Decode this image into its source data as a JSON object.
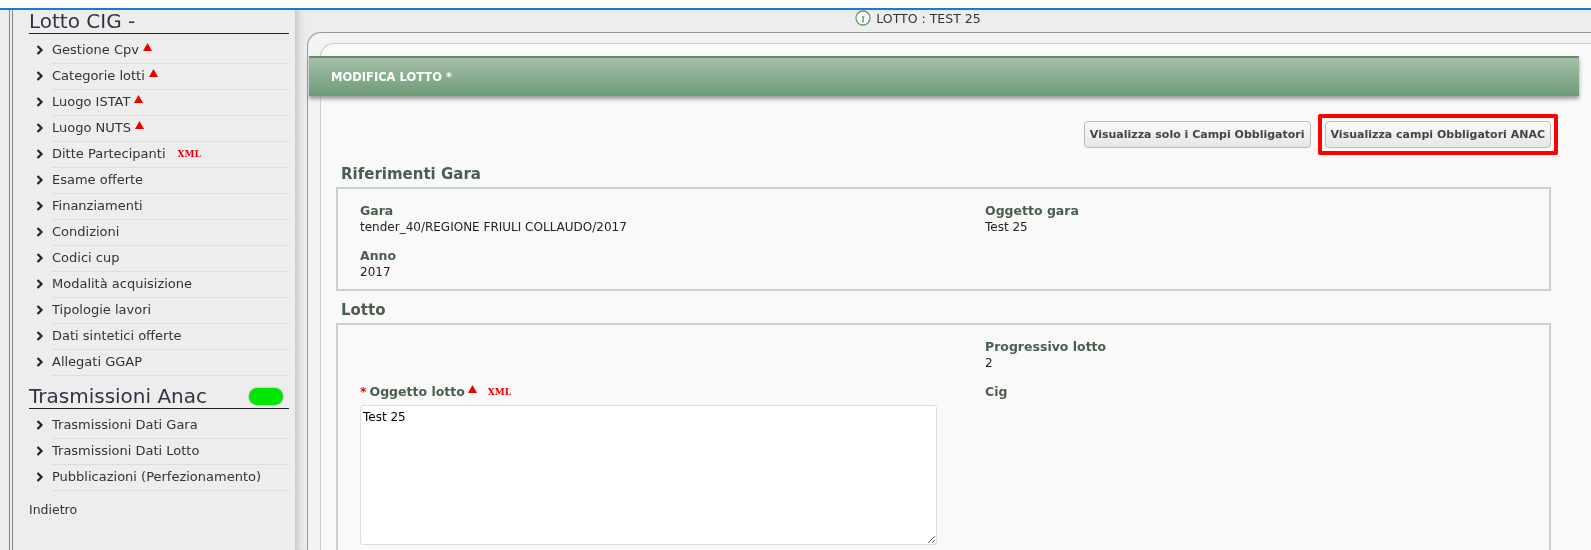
{
  "sidebar": {
    "sections": [
      {
        "title": "Lotto CIG -",
        "items": [
          {
            "label": "Gestione Cpv",
            "warning": true
          },
          {
            "label": "Categorie lotti",
            "warning": true
          },
          {
            "label": "Luogo ISTAT",
            "warning": true
          },
          {
            "label": "Luogo NUTS",
            "warning": true
          },
          {
            "label": "Ditte Partecipanti",
            "warning": false,
            "tag": "XML"
          },
          {
            "label": "Esame offerte",
            "warning": false
          },
          {
            "label": "Finanziamenti",
            "warning": false
          },
          {
            "label": "Condizioni",
            "warning": false
          },
          {
            "label": "Codici cup",
            "warning": false
          },
          {
            "label": "Modalità acquisizione",
            "warning": false
          },
          {
            "label": "Tipologie lavori",
            "warning": false
          },
          {
            "label": "Dati sintetici offerte",
            "warning": false
          },
          {
            "label": "Allegati GGAP",
            "warning": false
          }
        ]
      },
      {
        "title": "Trasmissioni Anac",
        "color": "#00e600",
        "items": [
          {
            "label": "Trasmissioni Dati Gara",
            "warning": false
          },
          {
            "label": "Trasmissioni Dati Lotto",
            "warning": false
          },
          {
            "label": "Pubblicazioni (Perfezionamento)",
            "warning": false
          }
        ]
      }
    ],
    "back_link": "Indietro"
  },
  "header": {
    "title": "LOTTO : TEST 25"
  },
  "panel": {
    "title": "MODIFICA LOTTO *",
    "buttons": [
      {
        "label": "Visualizza solo i Campi Obbligatori",
        "highlighted": false
      },
      {
        "label": "Visualizza campi Obbligatori ANAC",
        "highlighted": true
      }
    ],
    "sections": [
      {
        "title": "Riferimenti Gara",
        "rows": [
          {
            "left": {
              "kind": "text",
              "label": "Gara",
              "value": "tender_40/REGIONE FRIULI COLLAUDO/2017"
            },
            "right": {
              "kind": "text",
              "label": "Oggetto gara",
              "value": "Test 25"
            }
          },
          {
            "left": {
              "kind": "text",
              "label": "Anno",
              "value": "2017"
            }
          }
        ]
      },
      {
        "title": "Lotto",
        "rows": [
          {
            "right": {
              "kind": "text",
              "label": "Progressivo lotto",
              "value": "2"
            }
          },
          {
            "left": {
              "kind": "textarea",
              "label": "Oggetto lotto",
              "required_mark": "*",
              "warning": true,
              "tag": "XML",
              "value": "Test 25"
            },
            "right": {
              "kind": "text",
              "label": "Cig"
            }
          }
        ]
      }
    ]
  }
}
